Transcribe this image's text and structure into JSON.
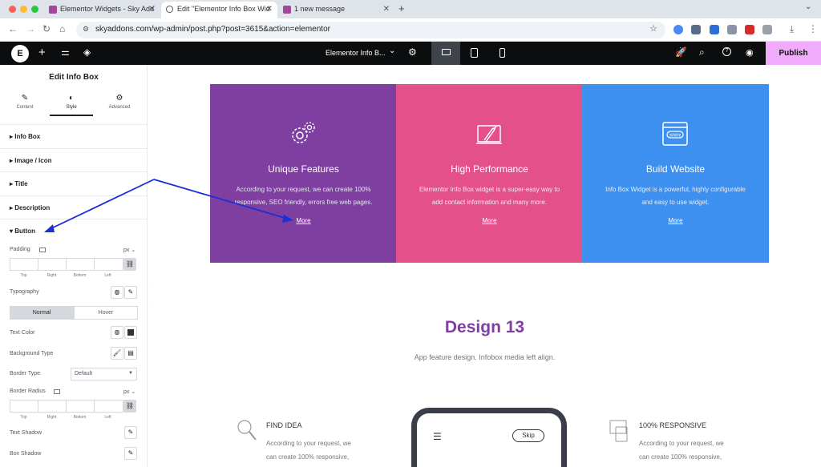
{
  "browser": {
    "tabs": [
      {
        "title": "Elementor Widgets - Sky Add"
      },
      {
        "title": "Edit \"Elementor Info Box Wid"
      },
      {
        "title": "1 new message"
      }
    ],
    "url": "skyaddons.com/wp-admin/post.php?post=3615&action=elementor"
  },
  "topbar": {
    "doc_title": "Elementor Info B...",
    "publish": "Publish"
  },
  "panel": {
    "title": "Edit Info Box",
    "tabs": [
      "Content",
      "Style",
      "Advanced"
    ],
    "sections": [
      "Info Box",
      "Image / Icon",
      "Title",
      "Description",
      "Button"
    ],
    "padding": {
      "label": "Padding",
      "unit": "px",
      "sides": [
        "Top",
        "Right",
        "Bottom",
        "Left"
      ]
    },
    "typography": "Typography",
    "state_tabs": [
      "Normal",
      "Hover"
    ],
    "text_color": "Text Color",
    "background_type": "Background Type",
    "border_type": {
      "label": "Border Type",
      "value": "Default"
    },
    "border_radius": {
      "label": "Border Radius",
      "unit": "px",
      "sides": [
        "Top",
        "Right",
        "Bottom",
        "Left"
      ]
    },
    "text_shadow": "Text Shadow",
    "box_shadow": "Box Shadow"
  },
  "cards": [
    {
      "title": "Unique Features",
      "desc": "According to your request, we can create 100% responsive, SEO friendly, errors free web pages.",
      "more": "More",
      "color": "#7e3fa1",
      "icon": "gears-icon"
    },
    {
      "title": "High Performance",
      "desc": "Elementor Info Box widget is a super-easy way to add contact information and many more.",
      "more": "More",
      "color": "#e4508a",
      "icon": "rocket-icon"
    },
    {
      "title": "Build Website",
      "desc": "Info Box Widget is a powerful, highly configurable and easy to use widget.",
      "more": "More",
      "color": "#3d8ff0",
      "icon": "browser-www-icon"
    }
  ],
  "design": {
    "heading": "Design 13",
    "subtitle": "App feature design. Infobox media left align.",
    "left_item": {
      "title": "FIND IDEA",
      "desc1": "According to your request, we",
      "desc2": "can create 100% responsive,"
    },
    "phone_skip": "Skip",
    "right_item": {
      "title": "100% RESPONSIVE",
      "desc1": "According to your request, we",
      "desc2": "can create 100% responsive,"
    }
  },
  "colors": {
    "accent": "#f0abfc",
    "heading_purple": "#7e3fa1",
    "annotation_arrow": "#1a2fd6"
  }
}
